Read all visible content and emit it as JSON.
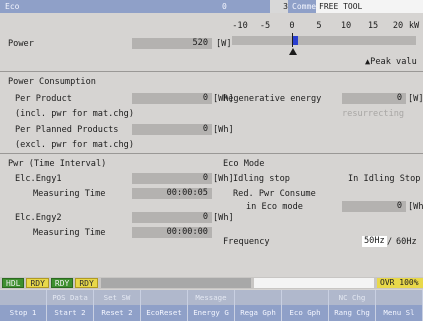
{
  "header": {
    "screen_name": "Eco",
    "num_a": "0",
    "num_b": "3",
    "comment_label": "Comment",
    "comment_value": "FREE TOOL"
  },
  "power": {
    "label": "Power",
    "value": "520",
    "unit": "[W]",
    "scale_ticks": [
      "-10",
      "-5",
      "0",
      "5",
      "10",
      "15",
      "20",
      "kW"
    ],
    "gauge_fraction": 0.026,
    "peak_label": "▲Peak valu"
  },
  "consumption": {
    "section_title": "Power Consumption",
    "per_product_label": "Per Product",
    "per_product_value": "0",
    "per_product_unit": "[Wh]",
    "per_product_note": "(incl. pwr for mat.chg)",
    "per_planned_label": "Per Planned Products",
    "per_planned_value": "0",
    "per_planned_unit": "[Wh]",
    "per_planned_note": "(excl. pwr for mat.chg)",
    "regen_label": "Regenerative energy",
    "regen_value": "0",
    "regen_unit": "[W]",
    "regen_status": "resurrecting"
  },
  "time_interval": {
    "section_title": "Pwr (Time Interval)",
    "elc1_label": "Elc.Engy1",
    "elc1_value": "0",
    "elc1_unit": "[Wh]",
    "elc1_time_label": "Measuring Time",
    "elc1_time_value": "00:00:05",
    "elc2_label": "Elc.Engy2",
    "elc2_value": "0",
    "elc2_unit": "[Wh]",
    "elc2_time_label": "Measuring Time",
    "elc2_time_value": "00:00:00"
  },
  "eco_mode": {
    "section_title": "Eco Mode",
    "idling_label": "Idling stop",
    "idling_value": "In Idling Stop",
    "red_label_1": "Red. Pwr Consume",
    "red_label_2": "in Eco mode",
    "red_value": "0",
    "red_unit": "[Wh",
    "freq_label": "Frequency",
    "freq_selected": "50Hz",
    "freq_sep": "/",
    "freq_other": "60Hz"
  },
  "status": {
    "hdl": "HDL",
    "rdy_1": "RDY",
    "rdy_2": "RDY",
    "rdy_3": "RDY",
    "ovr": "OVR 100%"
  },
  "menu_upper": [
    "",
    "POS Data",
    "Set SW",
    "",
    "Message",
    "",
    "",
    "NC Chg",
    ""
  ],
  "menu_lower": [
    "Stop 1",
    "Start 2",
    "Reset 2",
    "EcoReset",
    "Energy G",
    "Rega Gph",
    "Eco Gph",
    "Rang Chg",
    "Menu Sl"
  ],
  "colors": {
    "header_bg": "#8fa0c8",
    "gauge_fill": "#2a3fcf",
    "status_green": "#3e8f2e",
    "status_yellow": "#e8d84a"
  }
}
